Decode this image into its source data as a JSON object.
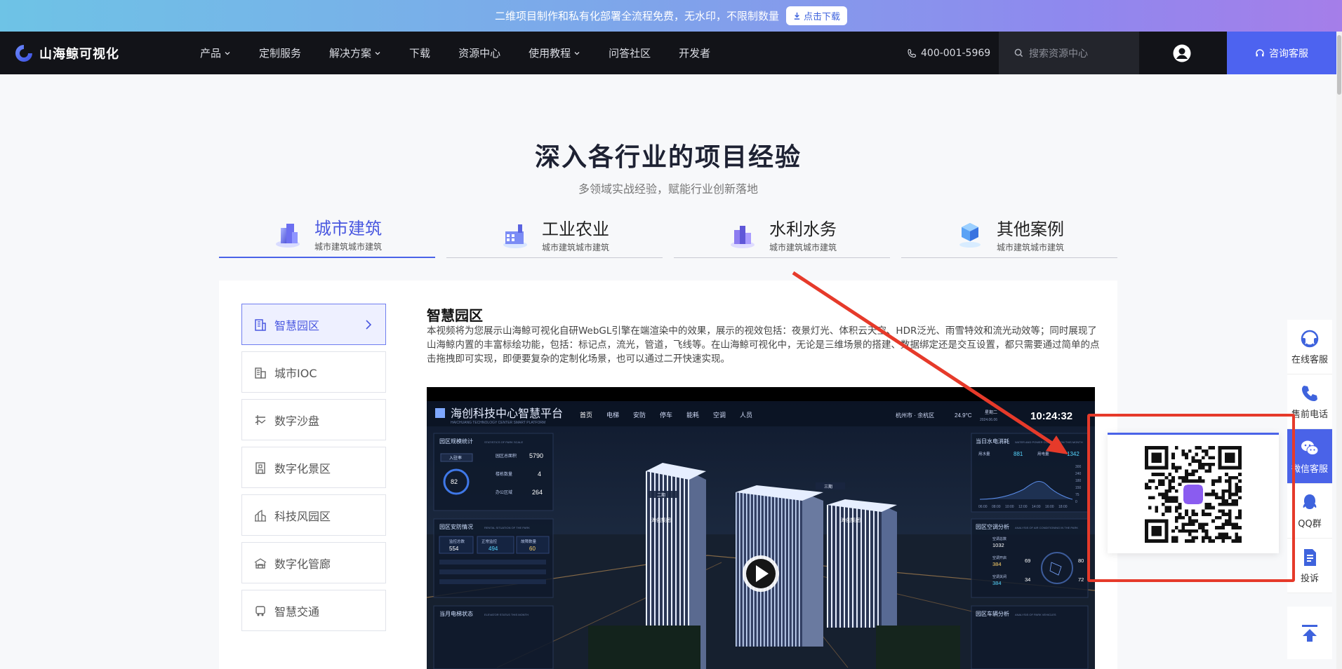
{
  "banner": {
    "text": "二维项目制作和私有化部署全流程免费，无水印，不限制数量",
    "button": "点击下载"
  },
  "nav": {
    "logo_text": "山海鲸可视化",
    "items": [
      {
        "label": "产品",
        "dropdown": true
      },
      {
        "label": "定制服务",
        "dropdown": false
      },
      {
        "label": "解决方案",
        "dropdown": true
      },
      {
        "label": "下载",
        "dropdown": false
      },
      {
        "label": "资源中心",
        "dropdown": false
      },
      {
        "label": "使用教程",
        "dropdown": true
      },
      {
        "label": "问答社区",
        "dropdown": false
      },
      {
        "label": "开发者",
        "dropdown": false
      }
    ],
    "phone": "400-001-5969",
    "search_placeholder": "搜索资源中心",
    "consult_label": "咨询客服"
  },
  "hero": {
    "title": "深入各行业的项目经验",
    "subtitle": "多领域实战经验，赋能行业创新落地"
  },
  "tabs": [
    {
      "title": "城市建筑",
      "sub": "城市建筑城市建筑",
      "icon": "city-building-icon",
      "active": true
    },
    {
      "title": "工业农业",
      "sub": "城市建筑城市建筑",
      "icon": "factory-icon",
      "active": false
    },
    {
      "title": "水利水务",
      "sub": "城市建筑城市建筑",
      "icon": "water-plant-icon",
      "active": false
    },
    {
      "title": "其他案例",
      "sub": "城市建筑城市建筑",
      "icon": "cubes-icon",
      "active": false
    }
  ],
  "sidebar": {
    "items": [
      {
        "label": "智慧园区",
        "active": true,
        "icon": "building-icon"
      },
      {
        "label": "城市IOC",
        "active": false,
        "icon": "city-icon"
      },
      {
        "label": "数字沙盘",
        "active": false,
        "icon": "sandbox-icon"
      },
      {
        "label": "数字化景区",
        "active": false,
        "icon": "scenic-icon"
      },
      {
        "label": "科技风园区",
        "active": false,
        "icon": "tech-park-icon"
      },
      {
        "label": "数字化管廊",
        "active": false,
        "icon": "pipe-gallery-icon"
      },
      {
        "label": "智慧交通",
        "active": false,
        "icon": "traffic-icon"
      }
    ]
  },
  "content": {
    "title": "智慧园区",
    "description": "本视频将为您展示山海鲸可视化自研WebGL引擎在端渲染中的效果，展示的视效包括：夜景灯光、体积云天空、HDR泛光、雨雪特效和流光动效等；同时展现了山海鲸内置的丰富标绘功能，包括：标记点，流光，管道，飞线等。在山海鲸可视化中，无论是三维场景的搭建、数据绑定还是交互设置，都只需要通过简单的点击拖拽即可实现，即便要复杂的定制化场景，也可以通过二开快速实现。"
  },
  "video": {
    "platform_title": "海创科技中心智慧平台",
    "platform_sub": "HAICHUANG TECHNOLOGY CENTER SMART PLATFORM",
    "menu": [
      "首页",
      "电梯",
      "安防",
      "停车",
      "能耗",
      "空调",
      "人员"
    ],
    "location": "杭州市 · 余杭区",
    "temperature": "24.9°C",
    "date": "2024.06.06",
    "weekday": "星期二",
    "time": "10:24:32",
    "panels": {
      "stats_title": "园区规模统计",
      "stats_sub": "STATISTICS OF PARK SCALE",
      "stats_rows": [
        {
          "label": "园区总面积",
          "value": "5790"
        },
        {
          "label": "楼栋数量",
          "value": "4"
        },
        {
          "label": "办公区域",
          "value": "264"
        }
      ],
      "circle_value": "82",
      "entry_label": "入驻率",
      "water_title": "当日水电消耗",
      "water_sub": "WATER AND POWER CONSUMPTION THIS MONTH",
      "water_label": "用水量",
      "water_value": "881",
      "power_label": "用电量",
      "power_value": "1342",
      "y_ticks": [
        "300",
        "240",
        "180",
        "150",
        "75",
        "0"
      ],
      "x_ticks": [
        "06:00",
        "08:00",
        "10:00",
        "12:00",
        "14:00",
        "16:00",
        "18:00"
      ],
      "security_title": "园区安防情况",
      "security_sub": "RENTAL SITUATION OF THE PARK",
      "cam_label": "监控总数",
      "cam_value": "554",
      "normal_label": "正常监控",
      "normal_value": "494",
      "fault_label": "故障数量",
      "fault_value": "60",
      "ac_title": "园区空调分析",
      "ac_sub": "ANALYSIS OF AIR CONDITIONING IN THE PARK",
      "ac_total_label": "空调总数",
      "ac_total": "1032",
      "ac_on_label": "空调开启",
      "ac_on": "384",
      "ac_off_label": "空调关闭",
      "ac_off": "384",
      "ac_fault": "69",
      "ac_repair": "34",
      "ac_device": "80",
      "ac_temp": "72",
      "elevator_title": "当月电梯状态",
      "elevator_sub": "ELEVATOR STATUS THIS MONTH",
      "car_title": "园区车辆分析",
      "car_sub": "ANALYSIS OF PARK VEHICLES",
      "building_labels": [
        "二期",
        "三期",
        "海创集团",
        "海创集团"
      ]
    }
  },
  "float_bar": {
    "items": [
      {
        "label": "在线客服",
        "icon": "headset-icon",
        "active": false
      },
      {
        "label": "售前电话",
        "icon": "phone-icon",
        "active": false
      },
      {
        "label": "微信客服",
        "icon": "wechat-icon",
        "active": true
      },
      {
        "label": "QQ群",
        "icon": "qq-icon",
        "active": false
      },
      {
        "label": "投诉",
        "icon": "complaint-icon",
        "active": false
      }
    ]
  },
  "colors": {
    "accent": "#4a63e8",
    "nav_bg": "#121318",
    "highlight": "#e63a2a"
  }
}
